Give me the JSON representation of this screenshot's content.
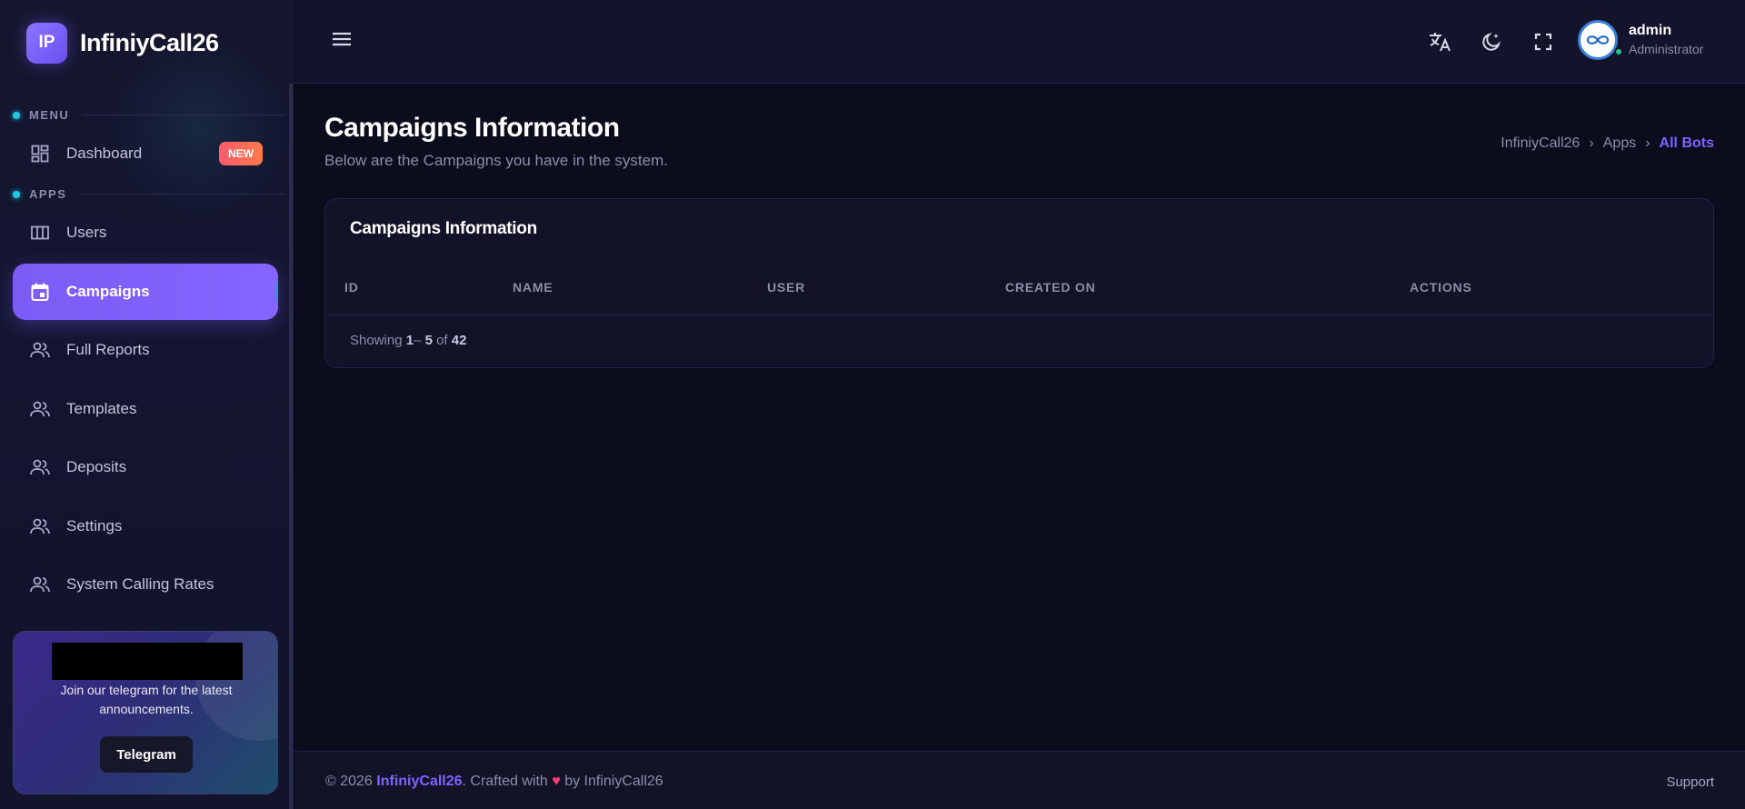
{
  "brand": {
    "logo_text": "IP",
    "name": "InfiniyCall26"
  },
  "sidebar": {
    "menu_label": "MENU",
    "apps_label": "APPS",
    "items": [
      {
        "label": "Dashboard",
        "icon": "dashboard-icon",
        "badge": "NEW"
      },
      {
        "label": "Users",
        "icon": "columns-icon"
      },
      {
        "label": "Campaigns",
        "icon": "calendar-icon",
        "active": true
      },
      {
        "label": "Full Reports",
        "icon": "users-icon"
      },
      {
        "label": "Templates",
        "icon": "users-icon"
      },
      {
        "label": "Deposits",
        "icon": "users-icon"
      },
      {
        "label": "Settings",
        "icon": "users-icon"
      },
      {
        "label": "System Calling Rates",
        "icon": "users-icon"
      }
    ],
    "promo": {
      "text": "Join our telegram for the latest announcements.",
      "button": "Telegram"
    }
  },
  "header": {
    "icons": [
      "menu-icon",
      "translate-icon",
      "theme-icon",
      "fullscreen-icon"
    ],
    "user": {
      "name": "admin",
      "role": "Administrator"
    }
  },
  "page": {
    "title": "Campaigns Information",
    "subtitle": "Below are the Campaigns you have in the system.",
    "breadcrumb": [
      "InfiniyCall26",
      "Apps",
      "All Bots"
    ]
  },
  "card": {
    "title": "Campaigns Information",
    "columns": [
      "ID",
      "NAME",
      "USER",
      "CREATED ON",
      "ACTIONS"
    ],
    "pagination": {
      "prefix": "Showing",
      "from": "1",
      "to": "5",
      "of_word": "of",
      "total": "42"
    }
  },
  "footer": {
    "copyright": "© 2026",
    "brand": "InfiniyCall26",
    "crafted": ". Crafted with",
    "by": "by InfiniyCall26",
    "support": "Support"
  },
  "colors": {
    "accent": "#7b5cf5",
    "badge": "#ff5a6e",
    "background": "#0b0c1c"
  }
}
